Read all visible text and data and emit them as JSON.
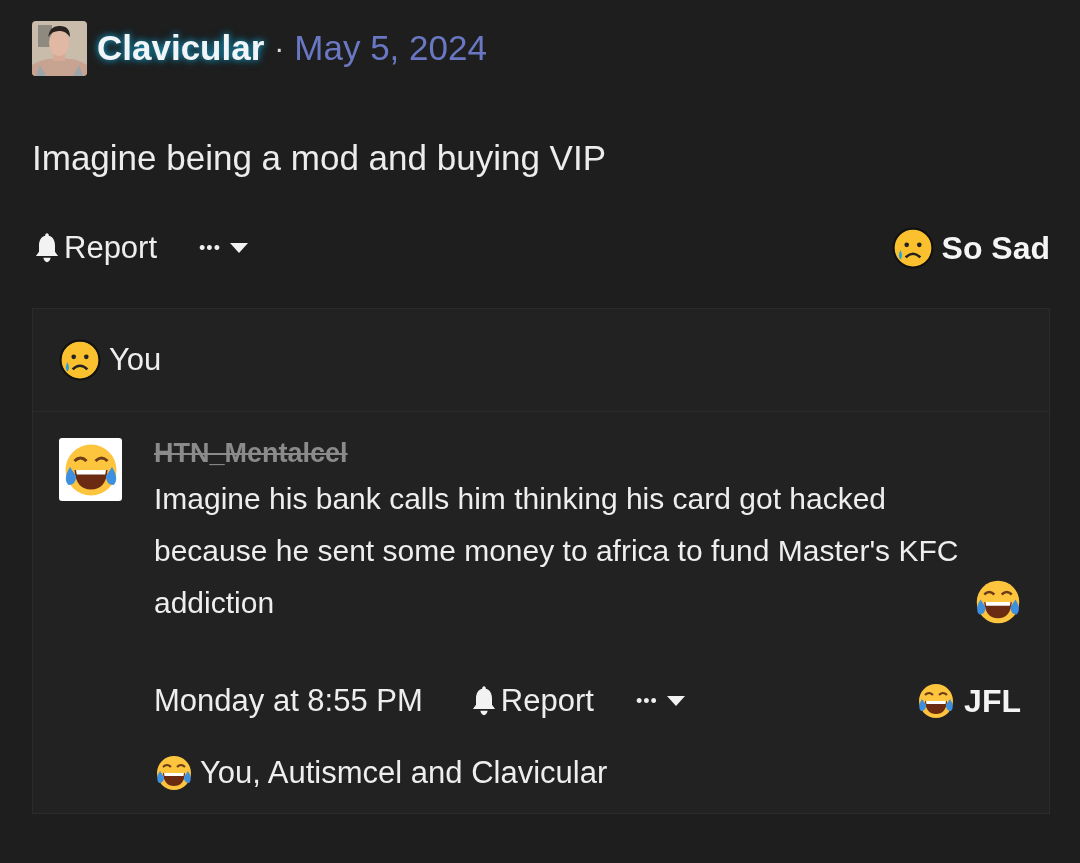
{
  "post": {
    "author": "Clavicular",
    "separator": "·",
    "date": "May 5, 2024",
    "text": "Imagine being a mod and buying VIP",
    "actions": {
      "report": "Report",
      "more": "•••",
      "reaction": {
        "kind": "sad",
        "label": "So Sad"
      }
    }
  },
  "reactions_summary": {
    "kind": "sad",
    "label": "You"
  },
  "comment": {
    "author": "HTN_Mentalcel",
    "struck": true,
    "avatar": {
      "kind": "laugh"
    },
    "text": "Imagine his bank calls him thinking his card got hacked because he sent some money to africa to fund Master's KFC addiction",
    "text_emoji": {
      "kind": "laugh"
    },
    "time": "Monday at 8:55 PM",
    "report": "Report",
    "more": "•••",
    "reaction": {
      "kind": "laugh",
      "label": "JFL"
    },
    "reactions_summary": {
      "kind": "laugh",
      "label": "You, Autismcel and Clavicular"
    }
  }
}
